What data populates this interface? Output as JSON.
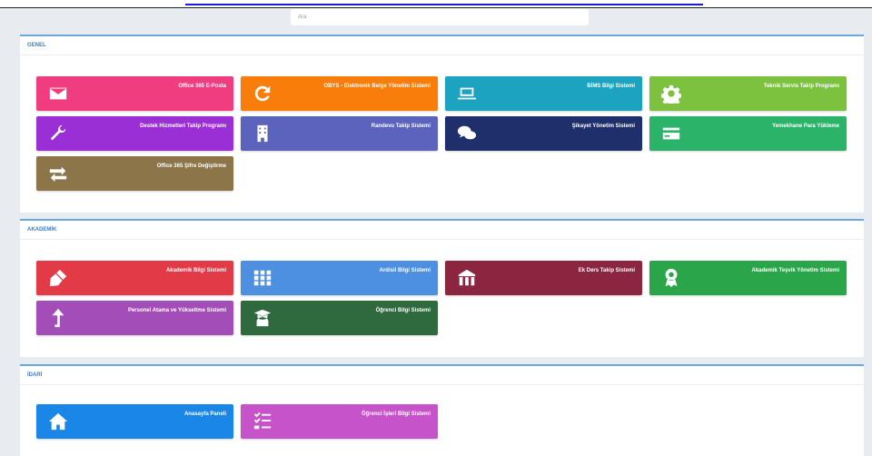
{
  "search": {
    "placeholder": "Ara"
  },
  "sections": [
    {
      "title": "GENEL",
      "tiles": [
        {
          "label": "Office 365 E-Posta",
          "icon": "envelope-icon",
          "color": "#f03d80"
        },
        {
          "label": "OBYS - Elektronik Belge Yönetim Sistemi",
          "icon": "refresh-icon",
          "color": "#f97d0b"
        },
        {
          "label": "BİMS Bilgi Sistemi",
          "icon": "laptop-icon",
          "color": "#1ca3bf"
        },
        {
          "label": "Teknik Servis Takip Programı",
          "icon": "gear-icon",
          "color": "#7cc23f"
        },
        {
          "label": "Destek Hizmetleri Takip Programı",
          "icon": "wrench-icon",
          "color": "#9b2fd6"
        },
        {
          "label": "Randevu Takip Sistemi",
          "icon": "building-icon",
          "color": "#5b63bd"
        },
        {
          "label": "Şikayet Yönetim Sistemi",
          "icon": "comments-icon",
          "color": "#1f2f6b"
        },
        {
          "label": "Yemekhane Para Yükleme",
          "icon": "credit-card-icon",
          "color": "#2cb36a"
        },
        {
          "label": "Office 365 Şifre Değiştirme",
          "icon": "exchange-icon",
          "color": "#8c7548"
        }
      ]
    },
    {
      "title": "AKADEMİK",
      "tiles": [
        {
          "label": "Akademik Bilgi Sistemi",
          "icon": "pen-nib-icon",
          "color": "#e33a48"
        },
        {
          "label": "Ardisil Bilgi Sistemi",
          "icon": "grid-icon",
          "color": "#4d8fe0"
        },
        {
          "label": "Ek Ders Takip Sistemi",
          "icon": "university-icon",
          "color": "#8c2540"
        },
        {
          "label": "Akademik Teşvik Yönetim Sistemi",
          "icon": "award-icon",
          "color": "#2aa54a"
        },
        {
          "label": "Personel Atama ve Yükseltme Sistemi",
          "icon": "level-up-icon",
          "color": "#a24db8"
        },
        {
          "label": "Öğrenci Bilgi Sistemi",
          "icon": "graduate-icon",
          "color": "#2e6a3e"
        }
      ]
    },
    {
      "title": "İDARİ",
      "tiles": [
        {
          "label": "Anasayfa Paneli",
          "icon": "home-icon",
          "color": "#1a86e8"
        },
        {
          "label": "Öğrenci İşleri Bilgi Sistemi",
          "icon": "tasks-icon",
          "color": "#c653c9"
        }
      ]
    }
  ]
}
